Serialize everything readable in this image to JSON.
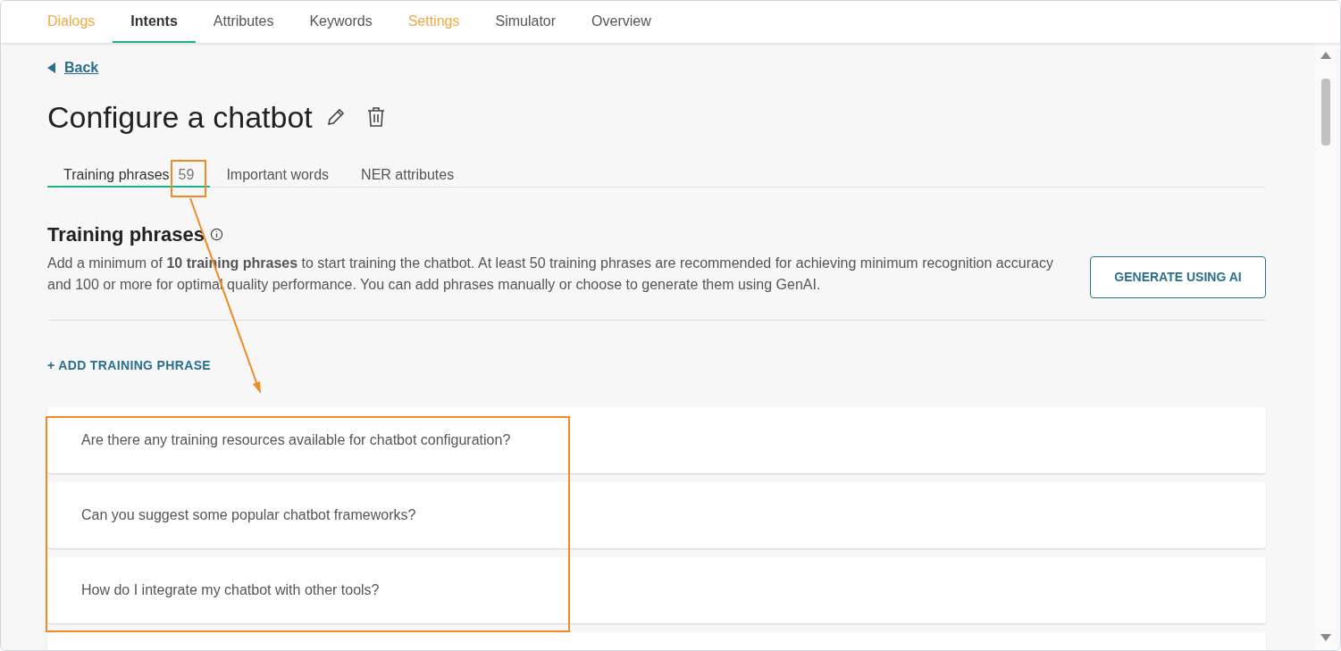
{
  "nav": [
    {
      "label": "Dialogs",
      "selected": false,
      "highlighted": true
    },
    {
      "label": "Intents",
      "selected": true,
      "highlighted": false
    },
    {
      "label": "Attributes",
      "selected": false,
      "highlighted": false
    },
    {
      "label": "Keywords",
      "selected": false,
      "highlighted": false
    },
    {
      "label": "Settings",
      "selected": false,
      "highlighted": true
    },
    {
      "label": "Simulator",
      "selected": false,
      "highlighted": false
    },
    {
      "label": "Overview",
      "selected": false,
      "highlighted": false
    }
  ],
  "back_link": "Back",
  "title": "Configure a chatbot",
  "tabs": [
    {
      "label": "Training phrases",
      "count": "59",
      "selected": true
    },
    {
      "label": "Important words",
      "selected": false
    },
    {
      "label": "NER attributes",
      "selected": false
    }
  ],
  "section": {
    "heading": "Training phrases",
    "description": "Add a minimum of **10 training phrases** to start training the chatbot. At least 50 training phrases are recommended for achieving minimum recognition accuracy and 100 or more for optimal quality performance. You can add phrases manually or choose to generate them using GenAI.",
    "generate_button": "GENERATE USING AI",
    "add_button": "+ ADD TRAINING PHRASE"
  },
  "phrases": [
    "Are there any training resources available for chatbot configuration?",
    "Can you suggest some popular chatbot frameworks?",
    "How do I integrate my chatbot with other tools?"
  ]
}
